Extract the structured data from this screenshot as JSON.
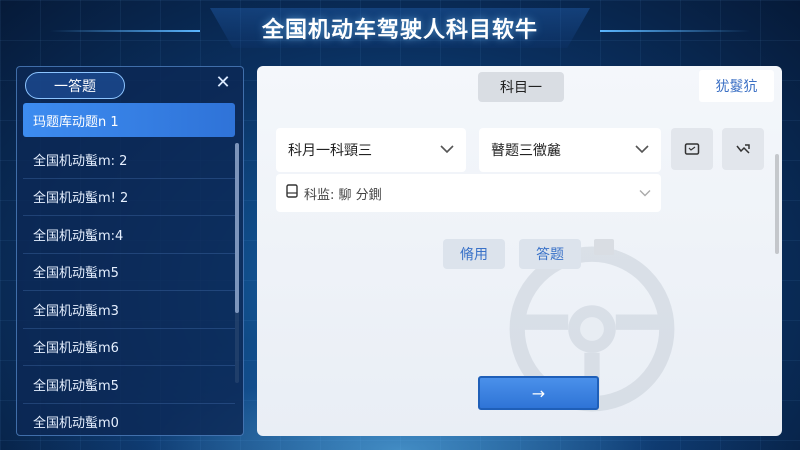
{
  "header": {
    "title": "全国机动车驾驶人科目软牛"
  },
  "sidebar": {
    "pill_label": "一答题",
    "close_icon": "close-icon",
    "items": [
      {
        "label": "玛题库动题n 1",
        "active": true
      },
      {
        "label": "全国机动蟚m: 2"
      },
      {
        "label": "全国机动蟚m! 2"
      },
      {
        "label": "全国机动蟚m:4"
      },
      {
        "label": "全国机动蟚m5"
      },
      {
        "label": "全国机动蟚m3"
      },
      {
        "label": "全国机动蟚m6"
      },
      {
        "label": "全国机动蟚m5"
      },
      {
        "label": "全国机动蟚m0"
      }
    ]
  },
  "main": {
    "tab_label": "科目一",
    "top_right_link": "犹鬉犺",
    "subject_select": "科月一科頸三",
    "type_select": "瞽题三徾麄",
    "field_label": "科监: 駠 分鍘",
    "action_1": "脩用",
    "action_2": "答题",
    "next_label": "→"
  },
  "colors": {
    "accent": "#3d8cf0",
    "panel_dark": "#0c2856",
    "panel_light": "#f4f7fb"
  }
}
